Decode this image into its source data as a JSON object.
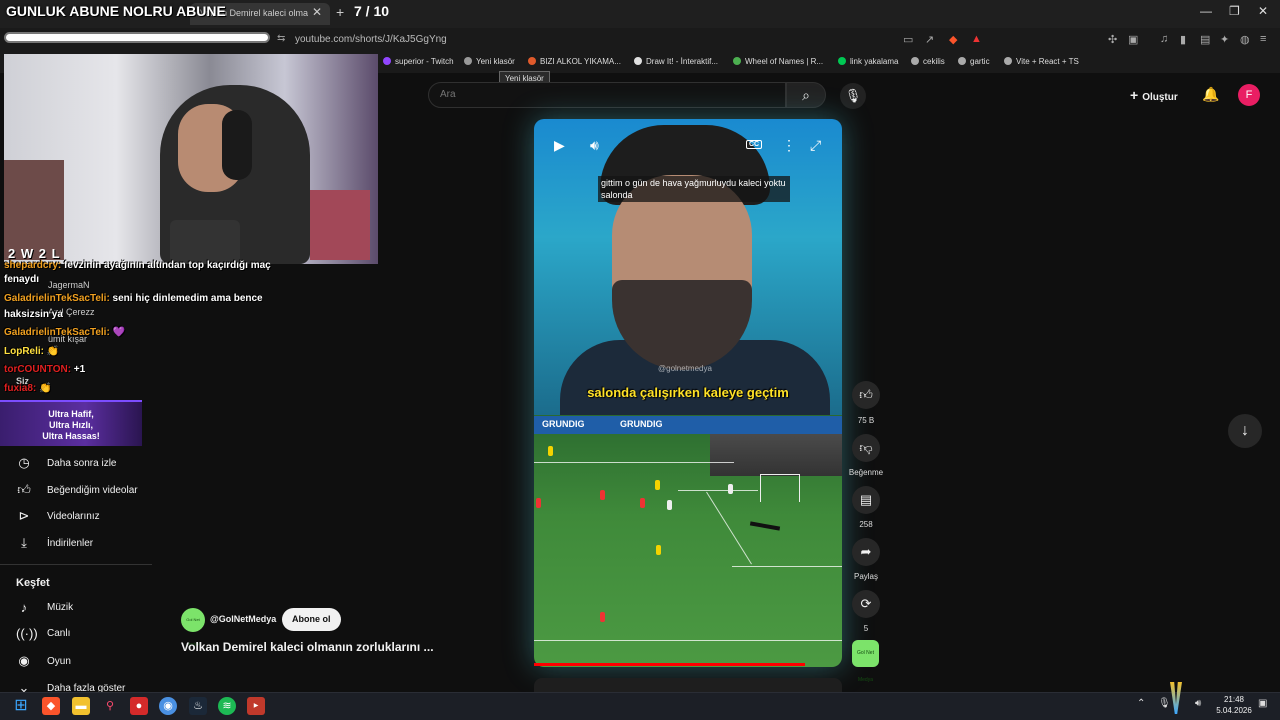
{
  "stream_overlay": {
    "title": "GUNLUK ABUNE NOLRU ABUNE",
    "counter": "7 / 10",
    "score": "2 W  2 L"
  },
  "browser": {
    "tab_title": "Volkan Demirel kaleci olmanın zo",
    "url": "youtube.com/shorts/J/KaJ5GgYng",
    "bookmarks": [
      {
        "label": "superior - Twitch",
        "color": "#9146ff"
      },
      {
        "label": "Yeni klasör",
        "color": "#999999"
      },
      {
        "label": "BIZI ALKOL YIKAMA...",
        "color": "#e05a2b"
      },
      {
        "label": "Draw It! - İnteraktif...",
        "color": "#e0e0e0"
      },
      {
        "label": "Wheel of Names | R...",
        "color": "#4caf50"
      },
      {
        "label": "link yakalama",
        "color": "#00c853"
      },
      {
        "label": "cekilis",
        "color": "#aaaaaa"
      },
      {
        "label": "gartic",
        "color": "#aaaaaa"
      },
      {
        "label": "Vite + React + TS",
        "color": "#aaaaaa"
      }
    ],
    "tooltip": "Yeni klasör"
  },
  "header": {
    "search_placeholder": "Ara",
    "create_label": "Oluştur",
    "avatar_letter": "F"
  },
  "chat": [
    {
      "user": "shepardcry:",
      "text": " fevzinin ayağının altından top kaçırdığı maç",
      "color": "o"
    },
    {
      "user": "",
      "text": "fenaydı",
      "color": "w"
    },
    {
      "user": "GaladrielinTekSacTeli:",
      "text": " seni hiç dinlemedim ama bence",
      "color": "o"
    },
    {
      "user": "",
      "text": "haksizsin ya",
      "color": "w"
    },
    {
      "user": "GaladrielinTekSacTeli:",
      "text": " 💜",
      "color": "o"
    },
    {
      "user": "LopReli:",
      "text": " 👏",
      "color": "y"
    },
    {
      "user": "torCOUNTON:",
      "text": " +1",
      "color": "r"
    },
    {
      "user": "fuxia8:",
      "text": " 👏",
      "color": "r"
    }
  ],
  "sidebar_ghost": [
    "JagermaN",
    "Anıl Çerezz",
    "ümit kışar",
    "Siz"
  ],
  "banner": {
    "line1": "Ultra Hafif,",
    "line2": "Ultra Hızlı,",
    "line3": "Ultra Hassas!"
  },
  "sidebar": {
    "items": [
      {
        "label": "Daha sonra izle",
        "icon": "clock-icon"
      },
      {
        "label": "Beğendiğim videolar",
        "icon": "thumb-up-icon"
      },
      {
        "label": "Videolarınız",
        "icon": "play-square-icon"
      },
      {
        "label": "İndirilenler",
        "icon": "download-icon"
      }
    ],
    "explore_title": "Keşfet",
    "explore": [
      {
        "label": "Müzik",
        "icon": "music-icon"
      },
      {
        "label": "Canlı",
        "icon": "live-icon"
      },
      {
        "label": "Oyun",
        "icon": "gamepad-icon"
      },
      {
        "label": "Daha fazla göster",
        "icon": "chevron-down-icon"
      }
    ]
  },
  "video": {
    "caption": "gittim o gün de hava yağmurluydu kaleci yoktu salonda",
    "watermark": "@golnetmedya",
    "subtitle": "salonda çalışırken kaleye geçtim",
    "board_text": [
      "GRUNDIG",
      "GRUNDIG"
    ],
    "progress": 0.88
  },
  "actions": {
    "likes": "75 B",
    "dislike_label": "Beğenme",
    "comments": "258",
    "share_label": "Paylaş",
    "remix": "5"
  },
  "channel": {
    "handle": "@GolNetMedya",
    "subscribe": "Abone ol",
    "title": "Volkan Demirel kaleci olmanın zorluklarını ...",
    "thumb_text": "Gol Net Medya"
  },
  "taskbar": {
    "time": "21:48",
    "date": "5.04.2026"
  }
}
